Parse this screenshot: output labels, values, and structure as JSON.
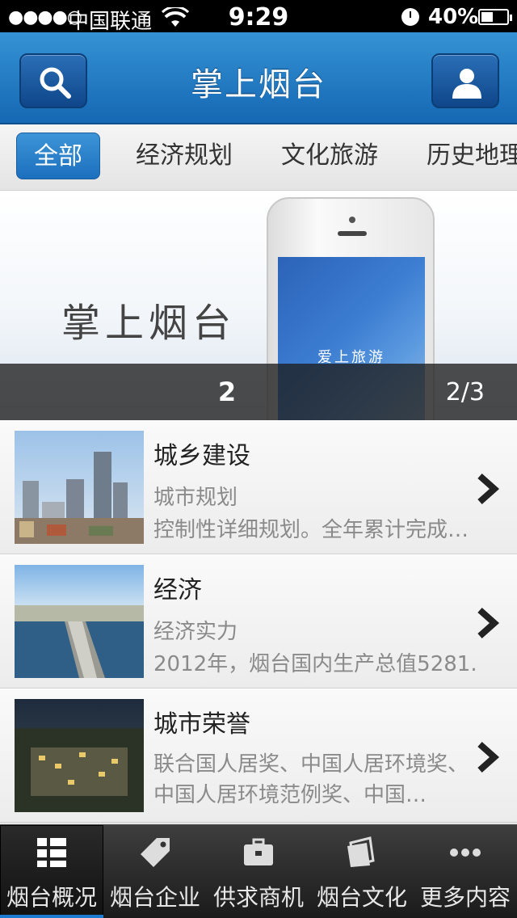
{
  "status_bar": {
    "signal": "●●●●○",
    "carrier": "中国联通",
    "time": "9:29",
    "battery": "40%"
  },
  "header": {
    "title": "掌上烟台",
    "search_icon": "search-icon",
    "user_icon": "user-icon"
  },
  "tabs": [
    {
      "label": "全部",
      "active": true
    },
    {
      "label": "经济规划"
    },
    {
      "label": "文化旅游"
    },
    {
      "label": "历史地理"
    }
  ],
  "banner": {
    "text": "掌上烟台",
    "phone_screen_text": "爱上旅游",
    "current": "2",
    "pager": "2/3"
  },
  "items": [
    {
      "title": "城乡建设",
      "subtitle": "城市规划",
      "desc": "控制性详细规划。全年累计完成…"
    },
    {
      "title": "经济",
      "subtitle": "经济实力",
      "desc": "2012年，烟台国内生产总值5281.…"
    },
    {
      "title": "城市荣誉",
      "desc": "联合国人居奖、中国人居环境奖、中国人居环境范例奖、中国…"
    }
  ],
  "tabbar": [
    {
      "label": "烟台概况",
      "icon": "grid-list-icon",
      "active": true
    },
    {
      "label": "烟台企业",
      "icon": "tag-icon"
    },
    {
      "label": "供求商机",
      "icon": "briefcase-icon"
    },
    {
      "label": "烟台文化",
      "icon": "book-icon"
    },
    {
      "label": "更多内容",
      "icon": "more-dots-icon"
    }
  ],
  "colors": {
    "header_blue": "#1568b3",
    "tab_active_blue": "#2a82cc",
    "tabbar_dark": "#1b1b1b"
  }
}
